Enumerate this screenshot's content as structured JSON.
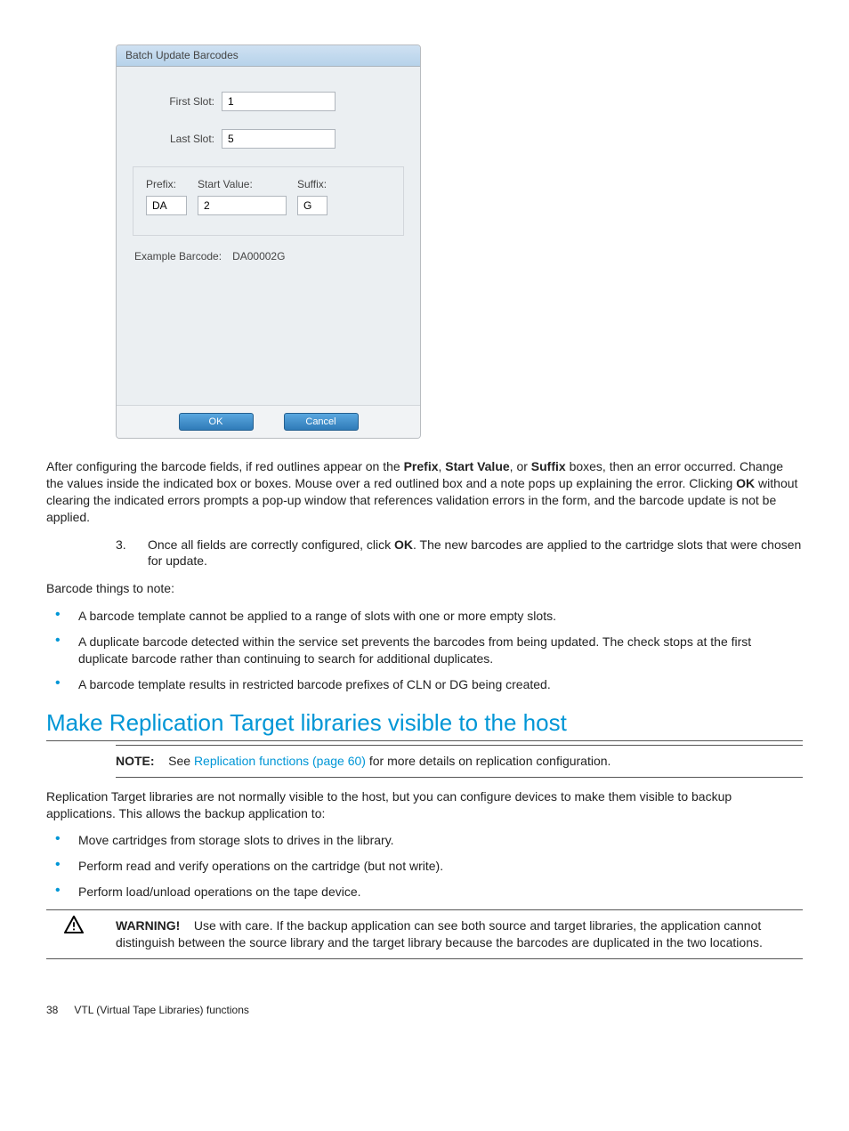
{
  "dialog": {
    "title": "Batch Update Barcodes",
    "first_slot_label": "First Slot:",
    "first_slot_value": "1",
    "last_slot_label": "Last Slot:",
    "last_slot_value": "5",
    "prefix_label": "Prefix:",
    "prefix_value": "DA",
    "start_value_label": "Start Value:",
    "start_value_value": "2",
    "suffix_label": "Suffix:",
    "suffix_value": "G",
    "example_label": "Example Barcode:",
    "example_value": "DA00002G",
    "ok_label": "OK",
    "cancel_label": "Cancel"
  },
  "body": {
    "para_after_red": {
      "p1": "After configuring the barcode fields, if red outlines appear on the ",
      "b1": "Prefix",
      "p2": ", ",
      "b2": "Start Value",
      "p3": ", or ",
      "b3": "Suffix",
      "p4": " boxes, then an error occurred. Change the values inside the indicated box or boxes. Mouse over a red outlined box and a note pops up explaining the error. Clicking ",
      "b4": "OK",
      "p5": " without clearing the indicated errors prompts a pop-up window that references validation errors in the form, and the barcode update is not be applied."
    },
    "step3_num": "3.",
    "step3": {
      "p1": "Once all fields are correctly configured, click ",
      "b1": "OK",
      "p2": ". The new barcodes are applied to the cartridge slots that were chosen for update."
    },
    "notes_heading": "Barcode things to note:",
    "notes": [
      "A barcode template cannot be applied to a range of slots with one or more empty slots.",
      "A duplicate barcode detected within the service set prevents the barcodes from being updated. The check stops at the first duplicate barcode rather than continuing to search for additional duplicates.",
      "A barcode template results in restricted barcode prefixes of CLN or DG being created."
    ],
    "section_heading": "Make Replication Target libraries visible to the host",
    "note_block": {
      "label": "NOTE:",
      "pre": "See ",
      "link": "Replication functions (page 60)",
      "post": " for more details on replication configuration."
    },
    "replication_intro": "Replication Target libraries are not normally visible to the host, but you can configure devices to make them visible to backup applications. This allows the backup application to:",
    "replication_bullets": [
      "Move cartridges from storage slots to drives in the library.",
      "Perform read and verify operations on the cartridge (but not write).",
      "Perform load/unload operations on the tape device."
    ],
    "warning": {
      "label": "WARNING!",
      "text": "Use with care. If the backup application can see both source and target libraries, the application cannot distinguish between the source library and the target library because the barcodes are duplicated in the two locations."
    }
  },
  "footer": {
    "page_number": "38",
    "chapter": "VTL (Virtual Tape Libraries) functions"
  }
}
